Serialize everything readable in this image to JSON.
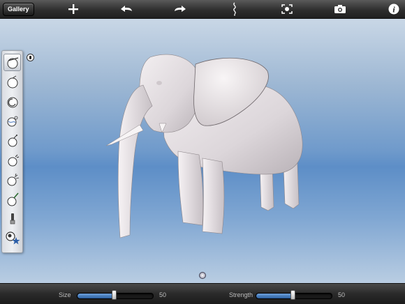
{
  "toolbar": {
    "gallery_label": "Gallery",
    "icons": [
      "add-icon",
      "undo-icon",
      "redo-icon",
      "subdivide-icon",
      "camera-reset-icon",
      "camera-icon",
      "info-icon"
    ]
  },
  "tools": [
    {
      "name": "standard-brush-icon",
      "selected": true
    },
    {
      "name": "smooth-brush-icon"
    },
    {
      "name": "grab-brush-icon"
    },
    {
      "name": "pinch-brush-icon"
    },
    {
      "name": "flatten-brush-icon"
    },
    {
      "name": "inflate-brush-icon"
    },
    {
      "name": "crease-brush-icon"
    },
    {
      "name": "paint-brush-icon"
    },
    {
      "name": "mask-icon"
    },
    {
      "name": "stamp-icon"
    }
  ],
  "sliders": {
    "size": {
      "label": "Size",
      "value": "50",
      "level": 0.5
    },
    "strength": {
      "label": "Strength",
      "value": "50",
      "level": 0.5
    }
  },
  "colors": {
    "accent": "#3f74bd",
    "model": "#e8e4e6"
  }
}
